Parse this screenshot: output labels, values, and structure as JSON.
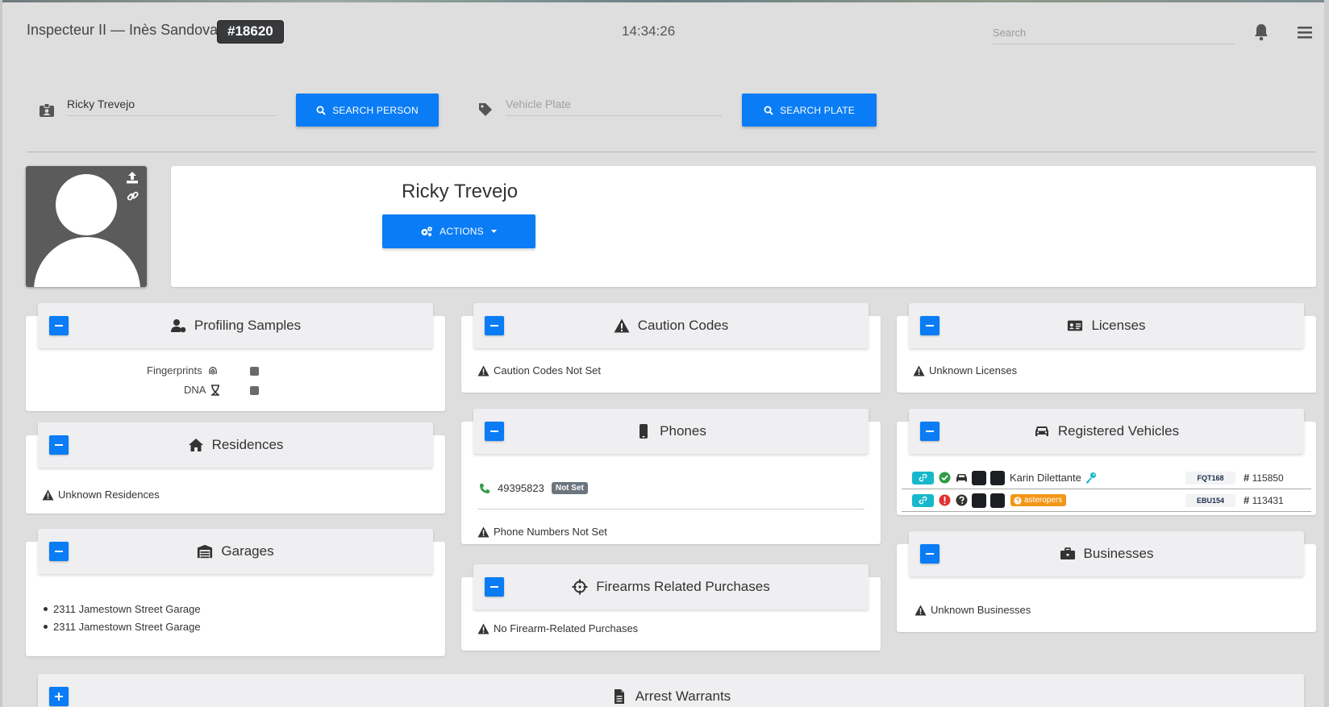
{
  "header": {
    "officer": "Inspecteur II — Inès Sandoval",
    "badge": "#18620",
    "clock": "14:34:26",
    "search_placeholder": "Search"
  },
  "search": {
    "person_value": "Ricky Trevejo",
    "person_button": "SEARCH PERSON",
    "plate_placeholder": "Vehicle Plate",
    "plate_button": "SEARCH PLATE"
  },
  "profile": {
    "name": "Ricky Trevejo",
    "actions_label": "ACTIONS"
  },
  "panels": {
    "profiling": {
      "title": "Profiling Samples",
      "fingerprints": "Fingerprints",
      "dna": "DNA"
    },
    "caution": {
      "title": "Caution Codes",
      "note": "Caution Codes Not Set"
    },
    "licenses": {
      "title": "Licenses",
      "note": "Unknown Licenses"
    },
    "residences": {
      "title": "Residences",
      "note": "Unknown Residences"
    },
    "phones": {
      "title": "Phones",
      "number": "49395823",
      "number_badge": "Not Set",
      "note": "Phone Numbers Not Set"
    },
    "vehicles": {
      "title": "Registered Vehicles",
      "rows": [
        {
          "owner": "Karin Dilettante",
          "org": "",
          "plate": "FQT168",
          "reg": "115850",
          "status": "ok"
        },
        {
          "owner": "",
          "org": "asteropers",
          "plate": "EBU154",
          "reg": "113431",
          "status": "alert"
        }
      ]
    },
    "garages": {
      "title": "Garages",
      "items": [
        "2311 Jamestown Street Garage",
        "2311 Jamestown Street Garage"
      ]
    },
    "firearms": {
      "title": "Firearms Related Purchases",
      "note": "No Firearm-Related Purchases"
    },
    "businesses": {
      "title": "Businesses",
      "note": "Unknown Businesses"
    },
    "warrants": {
      "title": "Arrest Warrants"
    }
  },
  "colors": {
    "accent": "#0a7cf5",
    "link_badge": "#17b8cc",
    "org_badge": "#f29617",
    "ok": "#2e9c46",
    "alert": "#e03131"
  }
}
